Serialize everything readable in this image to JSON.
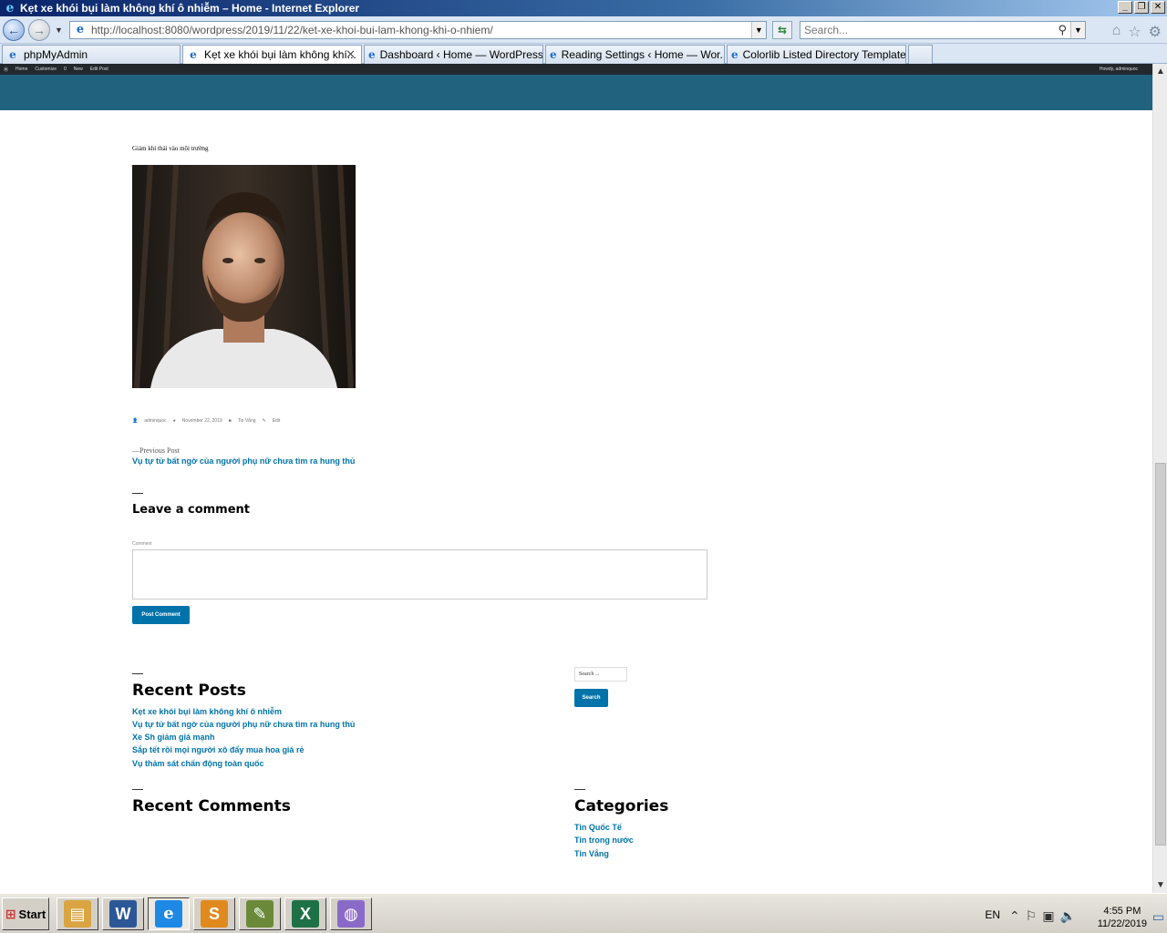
{
  "window": {
    "title": "Kẹt xe khói bụi làm không khí ô nhiễm – Home - Internet Explorer",
    "controls": [
      "_",
      "❐",
      "✕"
    ]
  },
  "address": {
    "url": "http://localhost:8080/wordpress/2019/11/22/ket-xe-khoi-bui-lam-khong-khi-o-nhiem/",
    "search_placeholder": "Search..."
  },
  "tabs": [
    {
      "label": "phpMyAdmin",
      "active": false
    },
    {
      "label": "Kẹt xe khói bụi làm không khí...",
      "active": true
    },
    {
      "label": "Dashboard ‹ Home — WordPress",
      "active": false
    },
    {
      "label": "Reading Settings ‹ Home — Wor...",
      "active": false
    },
    {
      "label": "Colorlib Listed Directory Template",
      "active": false
    }
  ],
  "wp_admin_bar": {
    "items": [
      "Home",
      "Customize",
      "0",
      "New",
      "Edit Post"
    ],
    "greeting": "Howdy, adminquoc"
  },
  "post": {
    "caption": "Giảm khí thải vào môi trường",
    "meta": {
      "author": "adminquoc",
      "date": "November 22, 2019",
      "category": "Tin Vắng",
      "edit": "Edit"
    },
    "prev_label": "—Previous Post",
    "prev_title": "Vụ tự tử bất ngờ của người phụ nữ chưa tìm ra hung thủ"
  },
  "comments": {
    "heading": "Leave a comment",
    "field_label": "Comment",
    "submit": "Post Comment"
  },
  "widgets": {
    "recent_posts": {
      "heading": "Recent Posts",
      "items": [
        "Kẹt xe khói bụi làm không khí ô nhiễm",
        "Vụ tự tử bất ngờ của người phụ nữ chưa tìm ra hung thủ",
        "Xe Sh giảm giá mạnh",
        "Sắp tết rồi mọi người xô đẩy mua hoa giá rẻ",
        "Vụ thảm sát chấn động toàn quốc"
      ]
    },
    "recent_comments": {
      "heading": "Recent Comments"
    },
    "search": {
      "placeholder": "Search ...",
      "button": "Search"
    },
    "categories": {
      "heading": "Categories",
      "items": [
        "Tin Quốc Tế",
        "Tin trong nước",
        "Tin Vắng"
      ]
    }
  },
  "taskbar": {
    "start": "Start",
    "apps": [
      {
        "name": "file-explorer",
        "glyph": "▤",
        "color": "#d9a441"
      },
      {
        "name": "word",
        "glyph": "W",
        "color": "#2b5797"
      },
      {
        "name": "internet-explorer",
        "glyph": "e",
        "color": "#1e88e5"
      },
      {
        "name": "sublime-text",
        "glyph": "S",
        "color": "#e08a1e"
      },
      {
        "name": "notepad",
        "glyph": "✎",
        "color": "#6a8a3a"
      },
      {
        "name": "excel",
        "glyph": "X",
        "color": "#1e7145"
      },
      {
        "name": "paint",
        "glyph": "◍",
        "color": "#8a6ac8"
      }
    ],
    "language": "EN",
    "time": "4:55 PM",
    "date": "11/22/2019"
  }
}
